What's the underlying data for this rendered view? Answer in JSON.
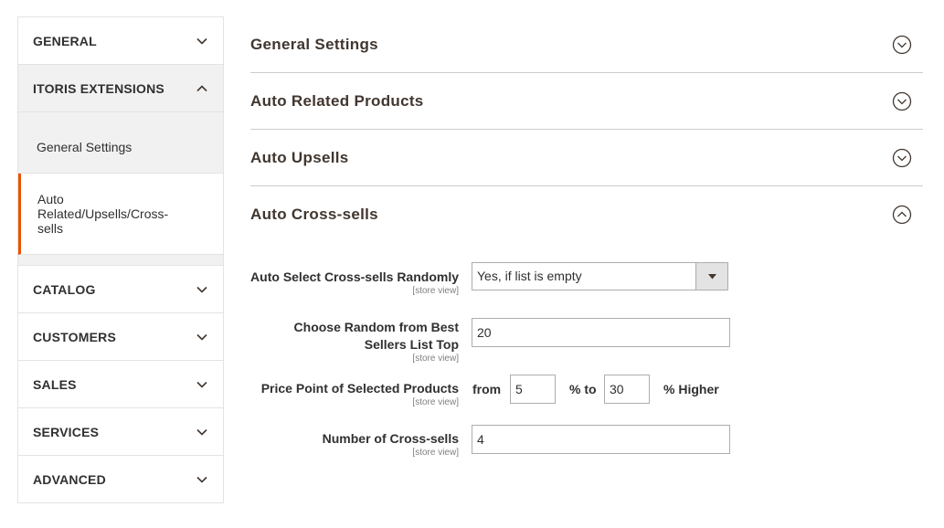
{
  "sidebar": {
    "top_sections": [
      {
        "label": "GENERAL",
        "expanded": false
      },
      {
        "label": "ITORIS EXTENSIONS",
        "expanded": true
      }
    ],
    "sub_items": [
      {
        "label": "General Settings",
        "active": false
      },
      {
        "label": "Auto Related/Upsells/Cross-sells",
        "active": true
      }
    ],
    "bottom_sections": [
      {
        "label": "CATALOG"
      },
      {
        "label": "CUSTOMERS"
      },
      {
        "label": "SALES"
      },
      {
        "label": "SERVICES"
      },
      {
        "label": "ADVANCED"
      }
    ]
  },
  "panels": [
    {
      "title": "General Settings",
      "expanded": false
    },
    {
      "title": "Auto Related Products",
      "expanded": false
    },
    {
      "title": "Auto Upsells",
      "expanded": false
    },
    {
      "title": "Auto Cross-sells",
      "expanded": true
    }
  ],
  "form": {
    "scope_label": "[store view]",
    "auto_select": {
      "label": "Auto Select Cross-sells Randomly",
      "value": "Yes, if list is empty"
    },
    "best_sellers": {
      "label_line1": "Choose Random from Best",
      "label_line2": "Sellers List Top",
      "value": "20"
    },
    "price_point": {
      "label": "Price Point of Selected Products",
      "from_text": "from",
      "from_value": "5",
      "to_text": "% to",
      "to_value": "30",
      "suffix_text": "% Higher"
    },
    "number": {
      "label": "Number of Cross-sells",
      "value": "4"
    }
  },
  "colors": {
    "accent": "#eb5202",
    "text": "#303030",
    "panel_title": "#41362f",
    "border": "#e3e3e3"
  },
  "icons": {
    "collapsed_section": "chevron-down-icon",
    "expanded_section": "chevron-up-icon",
    "panel_collapsed": "circle-chevron-down-icon",
    "panel_expanded": "circle-chevron-up-icon",
    "select": "caret-down-icon"
  }
}
